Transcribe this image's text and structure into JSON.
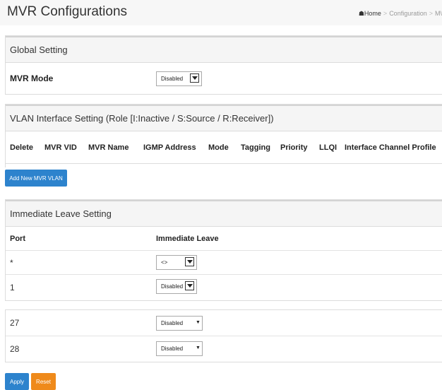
{
  "page": {
    "title": "MVR Configurations",
    "breadcrumb": {
      "home": "Home",
      "sep1": ">",
      "section": "Configuration",
      "sep2": ">",
      "current": "M\\"
    }
  },
  "global": {
    "heading": "Global Setting",
    "mvr_mode_label": "MVR Mode",
    "mvr_mode_value": "Disabled"
  },
  "vlan": {
    "heading": "VLAN Interface Setting (Role [I:Inactive / S:Source / R:Receiver])",
    "columns": [
      "Delete",
      "MVR VID",
      "MVR Name",
      "IGMP Address",
      "Mode",
      "Tagging",
      "Priority",
      "LLQI",
      "Interface Channel Profile"
    ],
    "add_button": "Add New MVR VLAN"
  },
  "leave": {
    "heading": "Immediate Leave Setting",
    "col_port": "Port",
    "col_leave": "Immediate Leave",
    "rows_top": [
      {
        "port": "*",
        "value": "<>"
      },
      {
        "port": "1",
        "value": "Disabled"
      }
    ],
    "rows_bottom": [
      {
        "port": "27",
        "value": "Disabled"
      },
      {
        "port": "28",
        "value": "Disabled"
      }
    ]
  },
  "buttons": {
    "apply": "Apply",
    "reset": "Reset"
  },
  "colors": {
    "apply": "#2d83cd",
    "reset": "#ef8a1b",
    "add": "#2d83cd"
  }
}
